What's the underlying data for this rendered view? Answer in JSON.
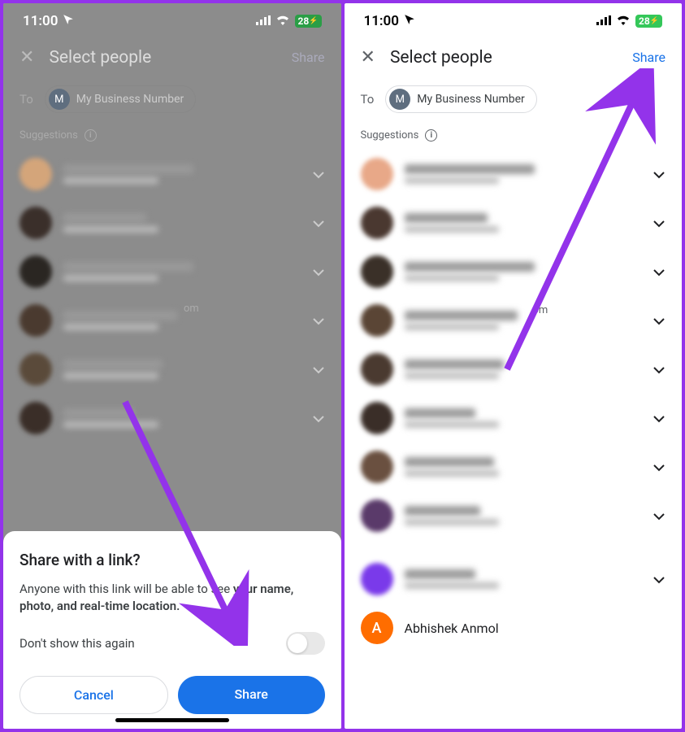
{
  "status": {
    "time": "11:00",
    "battery": "28",
    "battery_charging": true
  },
  "header": {
    "title": "Select people",
    "share": "Share"
  },
  "to": {
    "label": "To",
    "chip_initial": "M",
    "chip_label": "My Business Number"
  },
  "suggestions": {
    "label": "Suggestions"
  },
  "visible_suffix": "om",
  "clear_contact": {
    "initial": "A",
    "name": "Abhishek Anmol"
  },
  "sheet": {
    "title": "Share with a link?",
    "body_prefix": "Anyone with this link will be able to see ",
    "body_bold": "your name, photo, and real-time location.",
    "dont_show": "Don't show this again",
    "cancel": "Cancel",
    "share": "Share"
  },
  "left_contacts": [
    {
      "color": "#d4a57a",
      "name_w": "55%"
    },
    {
      "color": "#3a2f2a",
      "name_w": "35%"
    },
    {
      "color": "#2a2622",
      "name_w": "55%"
    },
    {
      "color": "#4a3a2f",
      "name_w": "48%"
    },
    {
      "color": "#5a4a3a",
      "name_w": "42%"
    },
    {
      "color": "#3a2e28",
      "name_w": "30%"
    }
  ],
  "right_contacts": [
    {
      "color": "#e8a888",
      "name_w": "55%"
    },
    {
      "color": "#4a3830",
      "name_w": "35%"
    },
    {
      "color": "#3a3028",
      "name_w": "55%"
    },
    {
      "color": "#5a4535",
      "name_w": "48%"
    },
    {
      "color": "#4a3a30",
      "name_w": "42%"
    },
    {
      "color": "#3a2e28",
      "name_w": "30%"
    },
    {
      "color": "#6a5040",
      "name_w": "38%"
    },
    {
      "color": "#5a3a6a",
      "name_w": "32%"
    },
    {
      "spacer": true
    },
    {
      "color": "#7a3aea",
      "name_w": "30%"
    }
  ]
}
